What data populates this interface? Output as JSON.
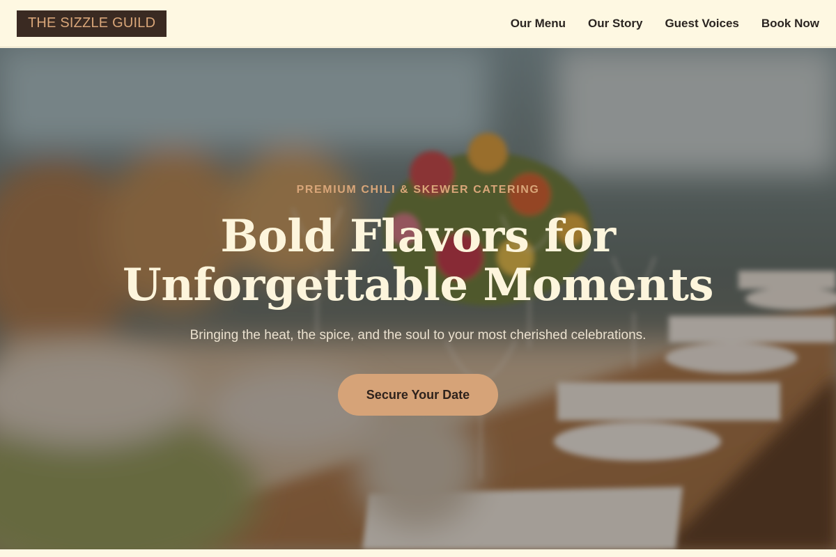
{
  "header": {
    "logo": "THE SIZZLE GUILD",
    "nav": [
      "Our Menu",
      "Our Story",
      "Guest Voices",
      "Book Now"
    ]
  },
  "hero": {
    "eyebrow": "PREMIUM CHILI & SKEWER CATERING",
    "headline_line1": "Bold Flavors for",
    "headline_line2": "Unforgettable Moments",
    "subtitle": "Bringing the heat, the spice, and the soul to your most cherished celebrations.",
    "cta": "Secure Your Date"
  },
  "colors": {
    "header_bg": "#fef8e2",
    "logo_bg": "#3a2a22",
    "logo_text": "#d9a679",
    "accent": "#d6a378",
    "headline": "#fdf5dc"
  }
}
